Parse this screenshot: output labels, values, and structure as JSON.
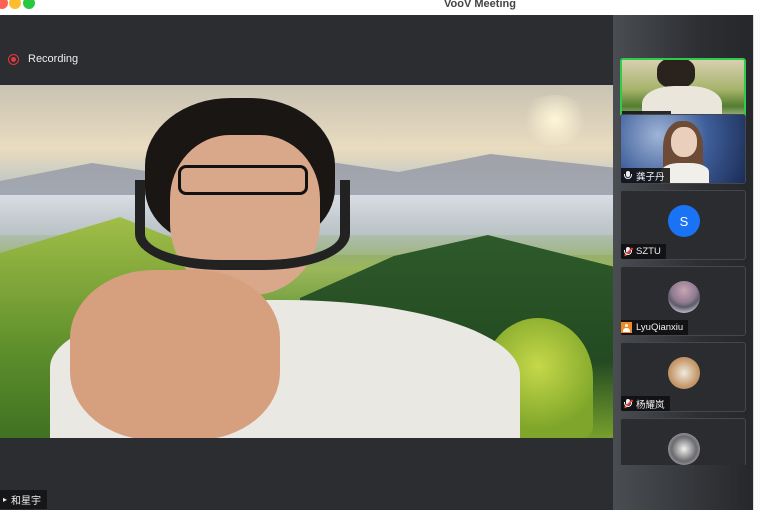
{
  "window": {
    "title": "VooV Meeting"
  },
  "recording": {
    "label": "Recording"
  },
  "main_video": {
    "speaker_name": "和星宇"
  },
  "participants": [
    {
      "name": "和星宇",
      "mic": "on",
      "type": "video",
      "active": true
    },
    {
      "name": "龚子丹",
      "mic": "on",
      "type": "video",
      "active": false
    },
    {
      "name": "SZTU",
      "mic": "muted",
      "type": "initial",
      "initial": "S"
    },
    {
      "name": "LyuQianxiu",
      "mic": "none",
      "type": "avatar"
    },
    {
      "name": "杨耀岚",
      "mic": "muted",
      "type": "avatar"
    },
    {
      "name": "",
      "mic": "",
      "type": "avatar"
    }
  ],
  "colors": {
    "active_border": "#2ecc4a",
    "recording": "#e0393e",
    "avatar_blue": "#1a73f5",
    "guest_icon": "#f08a24"
  }
}
